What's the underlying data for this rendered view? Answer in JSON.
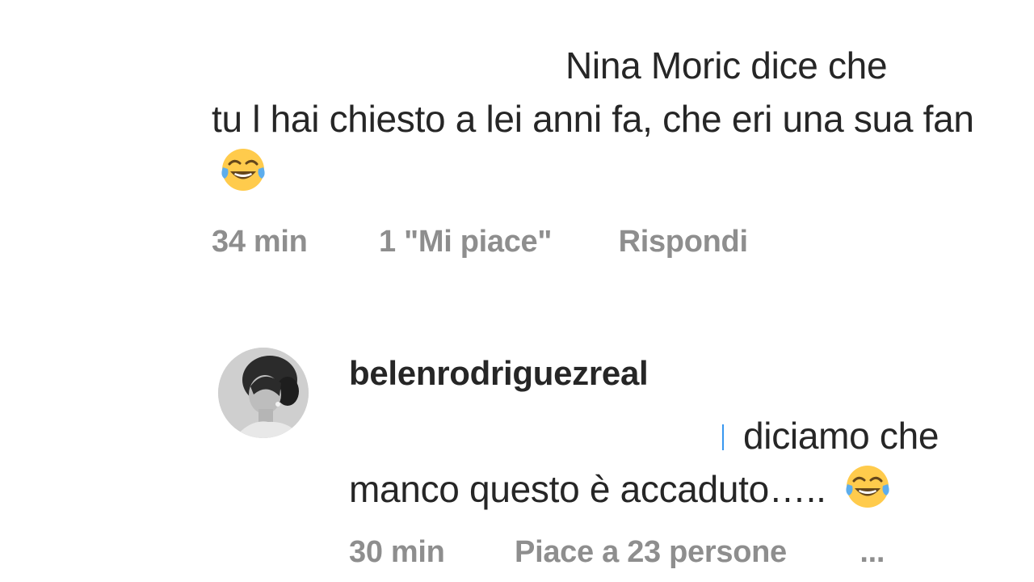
{
  "comments": [
    {
      "text_line1": "Nina Moric dice che",
      "text_rest": "tu l hai chiesto a lei anni fa, che eri una sua fan",
      "emoji": "face-with-tears-of-joy-icon",
      "time": "34 min",
      "likes": "1 \"Mi piace\"",
      "reply_label": "Rispondi"
    },
    {
      "username": "belenrodriguezreal",
      "avatar": "avatar-icon",
      "text_line1": "diciamo che",
      "text_rest": "manco questo è accaduto…..",
      "emoji": "face-with-tears-of-joy-icon",
      "time": "30 min",
      "likes": "Piace a 23 persone",
      "more_label": "..."
    }
  ],
  "colors": {
    "text": "#262626",
    "meta": "#8e8e8e",
    "emoji_face": "#ffcb4c",
    "emoji_tear": "#5dadec"
  }
}
